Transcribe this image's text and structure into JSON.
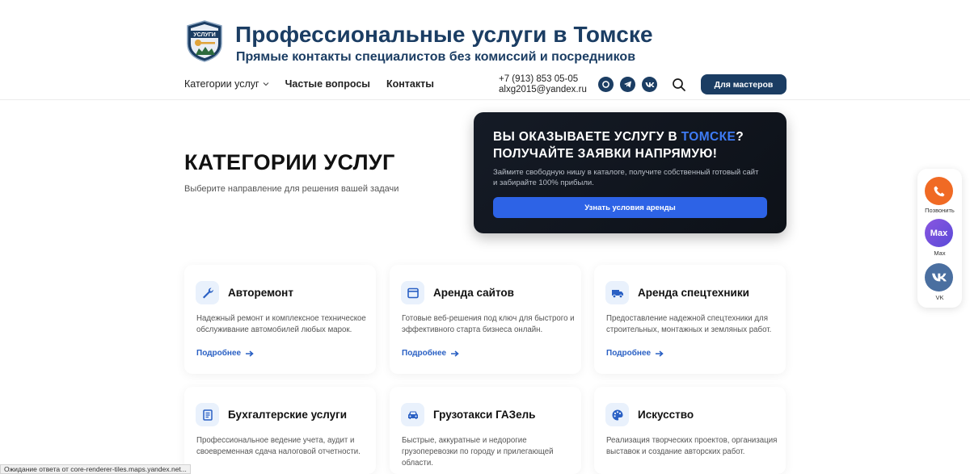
{
  "header": {
    "title": "Профессиональные услуги в Томске",
    "subtitle": "Прямые контакты специалистов без комиссий и посредников",
    "logo_text": "УСЛУГИ",
    "nav": [
      {
        "label": "Категории услуг"
      },
      {
        "label": "Частые вопросы"
      },
      {
        "label": "Контакты"
      }
    ],
    "phone": "+7 (913) 853 05-05",
    "email": "alxg2015@yandex.ru",
    "masters_button": "Для мастеров"
  },
  "hero": {
    "title": "КАТЕГОРИИ УСЛУГ",
    "subtitle": "Выберите направление для решения вашей задачи"
  },
  "promo": {
    "title_part1": "ВЫ ОКАЗЫВАЕТЕ УСЛУГУ В ",
    "title_accent": "ТОМСКЕ",
    "title_part2": "?",
    "title_line2": "ПОЛУЧАЙТЕ ЗАЯВКИ НАПРЯМУЮ!",
    "text": "Займите свободную нишу в каталоге, получите собственный готовый сайт и забирайте 100% прибыли.",
    "button": "Узнать условия аренды"
  },
  "cards": [
    {
      "title": "Авторемонт",
      "desc": "Надежный ремонт и комплексное техническое обслуживание автомобилей любых марок.",
      "link": "Подробнее",
      "icon": "wrench-icon"
    },
    {
      "title": "Аренда сайтов",
      "desc": "Готовые веб-решения под ключ для быстрого и эффективного старта бизнеса онлайн.",
      "link": "Подробнее",
      "icon": "browser-window-icon"
    },
    {
      "title": "Аренда спецтехники",
      "desc": "Предоставление надежной спецтехники для строительных, монтажных и земляных работ.",
      "link": "Подробнее",
      "icon": "truck-icon"
    },
    {
      "title": "Бухгалтерские услуги",
      "desc": "Профессиональное ведение учета, аудит и своевременная сдача налоговой отчетности.",
      "icon": "document-icon"
    },
    {
      "title": "Грузотакси ГАЗель",
      "desc": "Быстрые, аккуратные и недорогие грузоперевозки по городу и прилегающей области.",
      "icon": "car-icon"
    },
    {
      "title": "Искусство",
      "desc": "Реализация творческих проектов, организация выставок и создание авторских работ.",
      "icon": "palette-icon"
    }
  ],
  "float_widget": {
    "call_label": "Позвонить",
    "max_label": "Max",
    "max_badge": "Max",
    "vk_label": "VK"
  },
  "status_bar": "Ожидание ответа от core-renderer-tiles.maps.yandex.net...",
  "colors": {
    "brand_dark": "#1b3d63",
    "accent_blue": "#2d63e6",
    "link_blue": "#2a60c4",
    "call_orange": "#f06a24",
    "max_purple": "#7b52d9",
    "vk_blue": "#4a6fa0"
  }
}
